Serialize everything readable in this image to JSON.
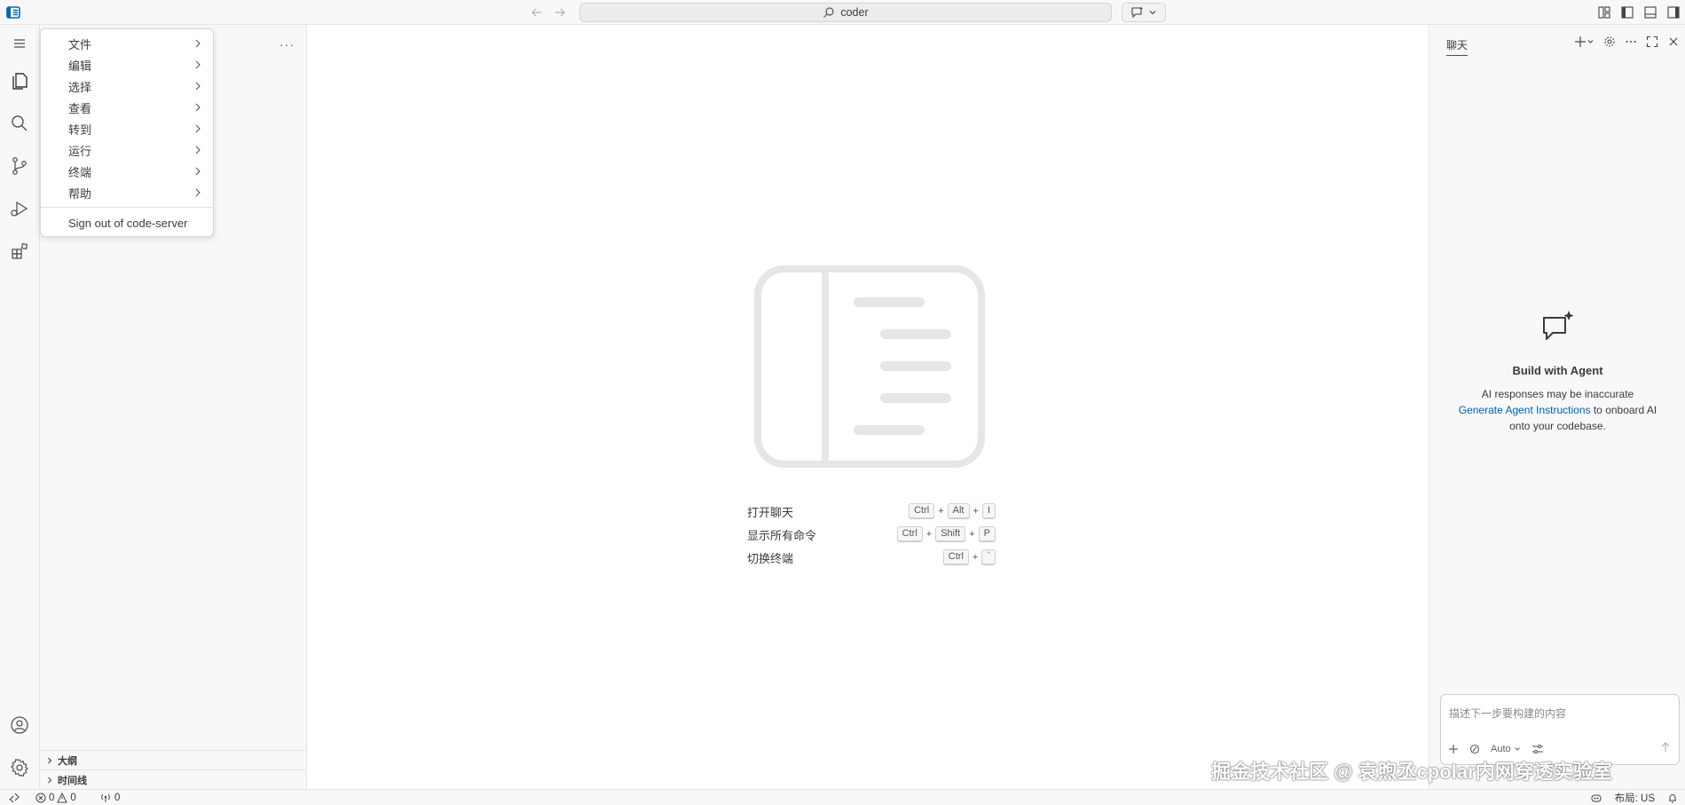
{
  "titlebar": {
    "search_text": "coder",
    "icons": [
      "app-logo-icon",
      "arrow-left-icon",
      "arrow-right-icon",
      "search-icon",
      "chat-icon",
      "chevron-down-icon",
      "layout-icon",
      "sidebar-toggle-icon",
      "panel-toggle-icon",
      "secondary-sidebar-toggle-icon"
    ]
  },
  "activitybar": {
    "items": [
      "menu-icon",
      "explorer-icon",
      "search-icon",
      "source-control-icon",
      "run-debug-icon",
      "extensions-icon",
      "account-icon",
      "settings-icon"
    ]
  },
  "menu": {
    "items": [
      {
        "label": "文件"
      },
      {
        "label": "编辑"
      },
      {
        "label": "选择"
      },
      {
        "label": "查看"
      },
      {
        "label": "转到"
      },
      {
        "label": "运行"
      },
      {
        "label": "终端"
      },
      {
        "label": "帮助"
      }
    ],
    "sign_out": "Sign out of code-server"
  },
  "sidebar": {
    "more": "···",
    "sections": [
      {
        "label": "大纲"
      },
      {
        "label": "时间线"
      }
    ]
  },
  "editor": {
    "shortcuts": [
      {
        "label": "打开聊天",
        "keys": [
          "Ctrl",
          "Alt",
          "I"
        ]
      },
      {
        "label": "显示所有命令",
        "keys": [
          "Ctrl",
          "Shift",
          "P"
        ]
      },
      {
        "label": "切换终端",
        "keys": [
          "Ctrl",
          "`"
        ]
      }
    ],
    "plus": "+"
  },
  "chat": {
    "tab_label": "聊天",
    "empty_title": "Build with Agent",
    "empty_line1": "AI responses may be inaccurate",
    "empty_link": "Generate Agent Instructions",
    "empty_line2_rest": " to onboard AI",
    "empty_line3": "onto your codebase.",
    "input_placeholder": "描述下一步要构建的内容",
    "mode": "Auto"
  },
  "statusbar": {
    "errors": "0",
    "warnings": "0",
    "ports": "0",
    "layout": "布局: US"
  },
  "watermark": "掘金技术社区 @ 袁煦丞cpolar内网穿透实验室",
  "colors": {
    "accent": "#005fb8",
    "border": "#e5e5e5",
    "background": "#f8f8f8",
    "editor_bg": "#ffffff"
  }
}
